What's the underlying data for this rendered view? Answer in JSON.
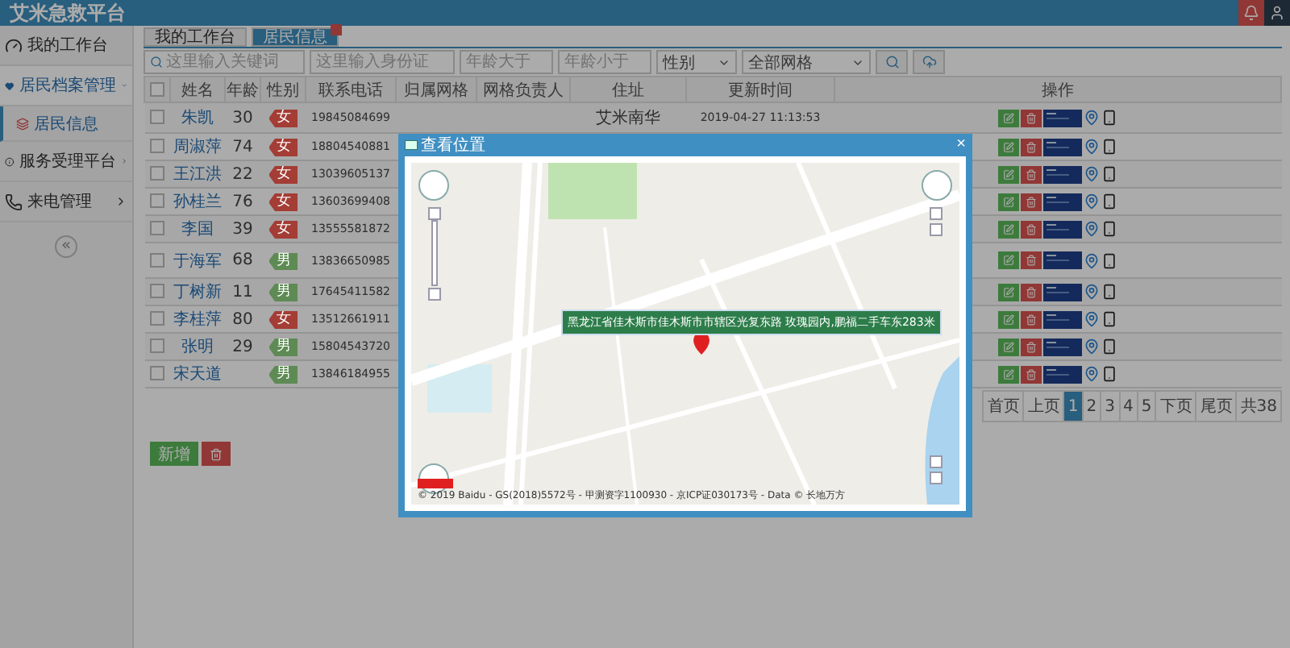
{
  "header": {
    "title": "艾米急救平台"
  },
  "sidebar": {
    "items": [
      {
        "label": "我的工作台",
        "selected": false
      },
      {
        "label": "居民档案管理",
        "expanded": true,
        "selected": true,
        "children": [
          {
            "label": "居民信息",
            "selected": true
          }
        ]
      },
      {
        "label": "服务受理平台",
        "expanded": false,
        "selected": false
      },
      {
        "label": "来电管理",
        "expanded": false,
        "selected": false
      }
    ],
    "collapse": "«"
  },
  "tabs": [
    {
      "label": "我的工作台",
      "selected": false,
      "closable": false
    },
    {
      "label": "居民信息",
      "selected": true,
      "closable": true
    }
  ],
  "filters": {
    "keyword": {
      "placeholder": "这里输入关键词"
    },
    "id_card": {
      "placeholder": "这里输入身份证"
    },
    "age_min": {
      "placeholder": "年龄大于"
    },
    "age_max": {
      "placeholder": "年龄小于"
    },
    "gender": {
      "value": "性别"
    },
    "grid": {
      "value": "全部网格"
    }
  },
  "table": {
    "all_checked": false,
    "columns": [
      "姓名",
      "年龄",
      "性别",
      "联系电话",
      "归属网格",
      "网格负责人",
      "住址",
      "更新时间",
      "操作"
    ],
    "rows": [
      {
        "name": "朱凯",
        "age": "30",
        "gender": "女",
        "color": "#a33d35",
        "phone": "19845084699",
        "address": "艾米南华",
        "updated": "2019-04-27 11:13:53",
        "checked": false
      },
      {
        "name": "周淑萍",
        "age": "74",
        "gender": "女",
        "color": "#a33d35",
        "phone": "18804540881",
        "checked": false
      },
      {
        "name": "王江洪",
        "age": "22",
        "gender": "女",
        "color": "#a33d35",
        "phone": "13039605137",
        "checked": false
      },
      {
        "name": "孙桂兰",
        "age": "76",
        "gender": "女",
        "color": "#a33d35",
        "phone": "13603699408",
        "checked": false
      },
      {
        "name": "李国",
        "age": "39",
        "gender": "女",
        "color": "#a33d35",
        "phone": "13555581872",
        "checked": false
      },
      {
        "name": "于海军",
        "age": "68",
        "gender": "男",
        "color": "#5e8a54",
        "phone": "13836650985",
        "checked": false
      },
      {
        "name": "丁树新",
        "age": "11",
        "gender": "男",
        "color": "#5e8a54",
        "phone": "17645411582",
        "checked": false
      },
      {
        "name": "李桂萍",
        "age": "80",
        "gender": "女",
        "color": "#a33d35",
        "phone": "13512661911",
        "checked": false
      },
      {
        "name": "张明",
        "age": "29",
        "gender": "男",
        "color": "#5e8a54",
        "phone": "15804543720",
        "checked": false
      },
      {
        "name": "宋天道",
        "age": "",
        "gender": "男",
        "color": "#5e8a54",
        "phone": "13846184955",
        "checked": false
      }
    ]
  },
  "buttons": {
    "add": "新增"
  },
  "pagination": [
    {
      "label": "首页",
      "selected": false
    },
    {
      "label": "上页",
      "selected": false
    },
    {
      "label": "1",
      "selected": true
    },
    {
      "label": "2",
      "selected": false
    },
    {
      "label": "3",
      "selected": false
    },
    {
      "label": "4",
      "selected": false
    },
    {
      "label": "5",
      "selected": false
    },
    {
      "label": "下页",
      "selected": false
    },
    {
      "label": "尾页",
      "selected": false
    },
    {
      "label": "共38",
      "selected": false
    }
  ],
  "dialog": {
    "title": "查看位置",
    "close": "×",
    "address": "黑龙江省佳木斯市佳木斯市市辖区光复东路 玫瑰园内,鹏福二手车东283米",
    "copyright": "© 2019 Baidu - GS(2018)5572号 - 甲测资字1100930 - 京ICP证030173号 - Data © 长地万方"
  }
}
